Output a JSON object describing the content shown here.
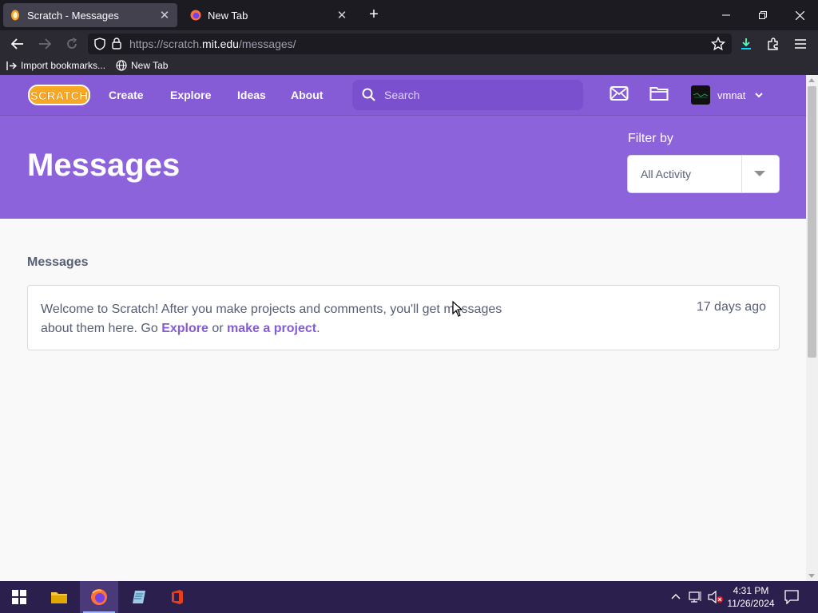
{
  "browser": {
    "tabs": [
      {
        "title": "Scratch - Messages",
        "active": true
      },
      {
        "title": "New Tab",
        "active": false
      }
    ],
    "url": {
      "prefix": "https://scratch.",
      "host": "mit.edu",
      "path": "/messages/"
    },
    "bookmarks": [
      "Import bookmarks...",
      "New Tab"
    ]
  },
  "scratch": {
    "nav": {
      "links": [
        "Create",
        "Explore",
        "Ideas",
        "About"
      ],
      "search_placeholder": "Search",
      "username": "vmnat"
    },
    "header": {
      "title": "Messages",
      "filter_label": "Filter by",
      "filter_value": "All Activity"
    },
    "messages": {
      "section_title": "Messages",
      "card": {
        "text_before": "Welcome to Scratch! After you make projects and comments, you'll get messages about them here. Go ",
        "link1": "Explore",
        "text_mid": " or ",
        "link2": "make a project",
        "text_after": ".",
        "time": "17 days ago"
      }
    }
  },
  "taskbar": {
    "time": "4:31 PM",
    "date": "11/26/2024"
  },
  "colors": {
    "scratch_purple": "#855cd6",
    "header_purple": "#8d63db",
    "taskbar": "#2b1f4d"
  }
}
